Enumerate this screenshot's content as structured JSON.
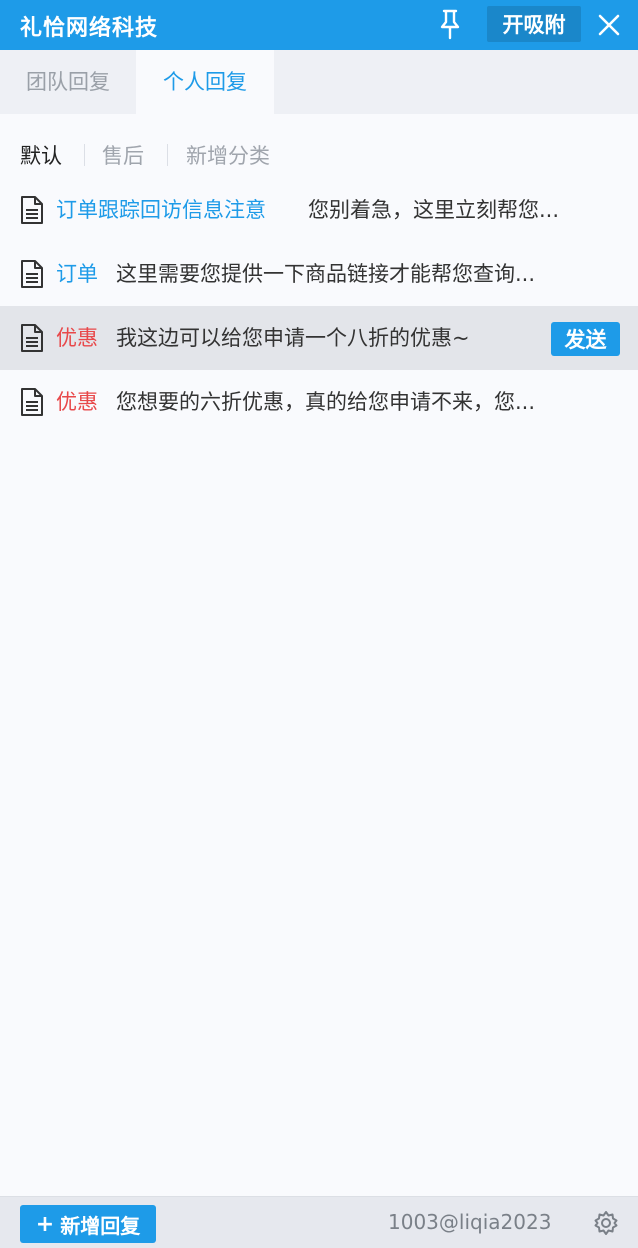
{
  "window": {
    "title": "礼恰网络科技",
    "attach_label": "开吸附"
  },
  "tabs": [
    {
      "label": "团队回复",
      "active": false
    },
    {
      "label": "个人回复",
      "active": true
    }
  ],
  "categories": [
    {
      "label": "默认",
      "active": true
    },
    {
      "label": "售后",
      "active": false
    },
    {
      "label": "新增分类",
      "active": false
    }
  ],
  "replies": [
    {
      "tag": "订单跟踪回访信息注意",
      "tag_color": "#1e9be8",
      "content": "您别着急，这里立刻帮您..."
    },
    {
      "tag": "订单",
      "tag_color": "#1e9be8",
      "content": "这里需要您提供一下商品链接才能帮您查询..."
    },
    {
      "tag": "优惠",
      "tag_color": "#e8484a",
      "content": "我这边可以给您申请一个八折的优惠~",
      "send_label": "发送"
    },
    {
      "tag": "优惠",
      "tag_color": "#e8484a",
      "content": "您想要的六折优惠，真的给您申请不来，您..."
    }
  ],
  "footer": {
    "add_label": "新增回复",
    "account": "1003@liqia2023"
  },
  "colors": {
    "accent": "#1e9be8",
    "tag_red": "#e8484a"
  }
}
